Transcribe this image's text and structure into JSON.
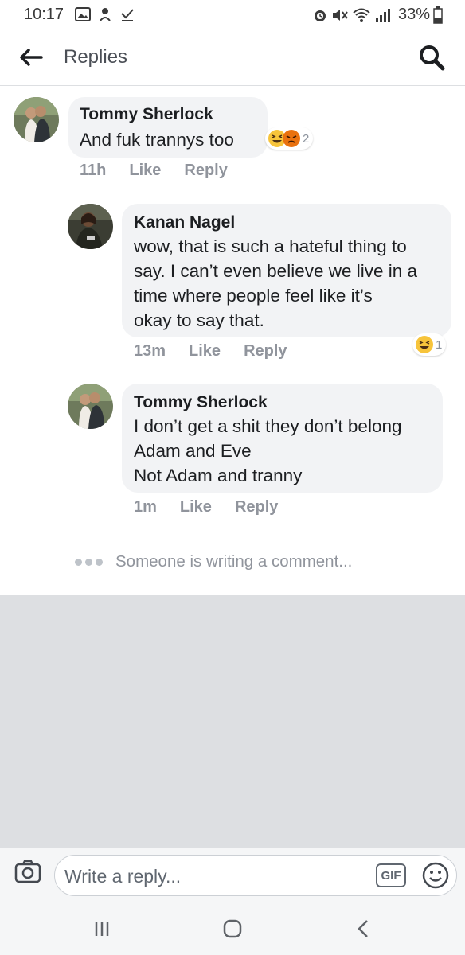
{
  "status_bar": {
    "time": "10:17",
    "battery_pct": "33%",
    "left_icons": [
      "image-icon",
      "download-icon",
      "check-icon"
    ],
    "right_icons": [
      "alarm-icon",
      "mute-icon",
      "wifi-icon",
      "signal-icon",
      "battery-icon"
    ]
  },
  "header": {
    "title": "Replies",
    "back_icon": "back-arrow-icon",
    "search_icon": "search-icon"
  },
  "comments": [
    {
      "author": "Tommy Sherlock",
      "text": "And fuk trannys too",
      "time": "11h",
      "like_label": "Like",
      "reply_label": "Reply",
      "reactions": [
        "laugh-react",
        "angry-react"
      ],
      "reaction_count": "2",
      "avatar": "couple-photo"
    },
    {
      "author": "Kanan Nagel",
      "text": "wow, that is such a hateful thing to\nsay. I can’t even believe we live in a\ntime where people feel like it’s\nokay to say that.",
      "time": "13m",
      "like_label": "Like",
      "reply_label": "Reply",
      "reactions": [
        "laugh-react"
      ],
      "reaction_count": "1",
      "avatar": "person-photo"
    },
    {
      "author": "Tommy Sherlock",
      "text": "I don’t get a shit they don’t belong\nAdam and Eve\nNot Adam and tranny",
      "time": "1m",
      "like_label": "Like",
      "reply_label": "Reply",
      "avatar": "couple-photo"
    }
  ],
  "typing_indicator": "Someone is writing a comment...",
  "composer": {
    "placeholder": "Write a reply...",
    "gif_label": "GIF",
    "camera_icon": "camera-icon",
    "emoji_icon": "smiley-icon"
  },
  "nav_bar": {
    "buttons": [
      "recents-icon",
      "home-icon",
      "back-icon"
    ]
  },
  "colors": {
    "bubble": "#f2f3f5",
    "meta_text": "#90949c",
    "divider_area": "#dddfe2",
    "laugh_yellow": "#f7c43b",
    "angry_orange": "#e9710f"
  }
}
